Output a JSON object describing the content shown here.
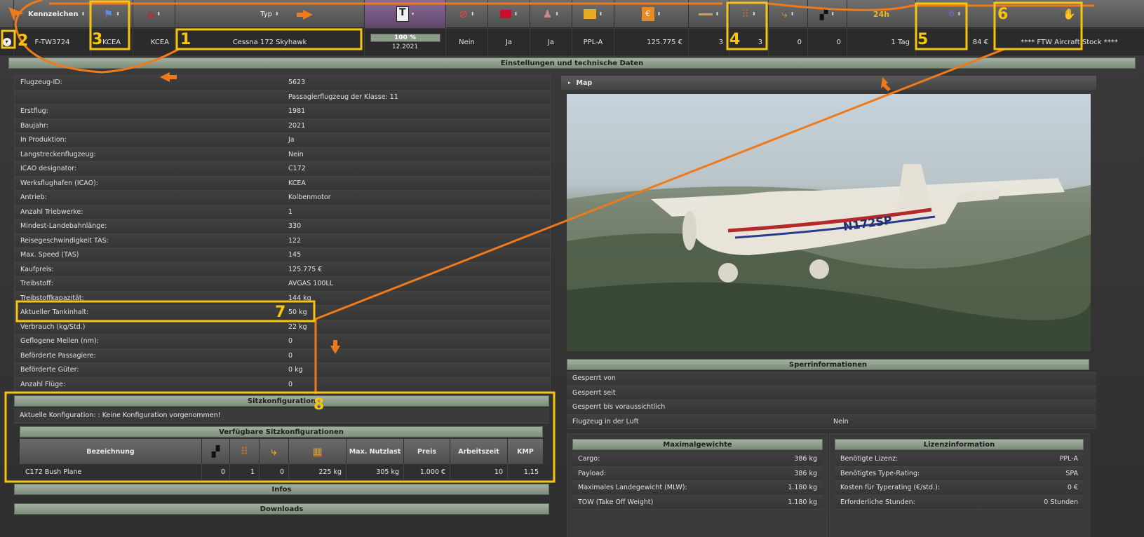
{
  "header": {
    "col_registration": "Kennzeichen",
    "col_type": "Typ",
    "col_24h": "24h"
  },
  "row": {
    "expand_icon": "chevron-down-icon",
    "registration": "F-TW3724",
    "location": "KCEA",
    "home": "KCEA",
    "type": "Cessna 172 Skyhawk",
    "condition_percent": "100 %",
    "condition_value": 1.0,
    "condition_date": "12.2021",
    "no_smoking": "Nein",
    "col_a": "Ja",
    "col_b": "Ja",
    "license": "PPL-A",
    "price": "125.775 €",
    "fuel_col": "3",
    "seats": "3",
    "cabin": "0",
    "first": "0",
    "rent_time": "1 Tag",
    "rent_price": "84 €",
    "owner": "**** FTW Aircraft Stock ****"
  },
  "section_title": "Einstellungen und technische Daten",
  "details": [
    {
      "k": "Flugzeug-ID:",
      "v": "5623"
    },
    {
      "k": "",
      "v": "Passagierflugzeug der Klasse: 11"
    },
    {
      "k": "Erstflug:",
      "v": "1981"
    },
    {
      "k": "Baujahr:",
      "v": "2021"
    },
    {
      "k": "In Produktion:",
      "v": "Ja"
    },
    {
      "k": "Langstreckenflugzeug:",
      "v": "Nein"
    },
    {
      "k": "ICAO designator:",
      "v": "C172"
    },
    {
      "k": "Werksflughafen (ICAO):",
      "v": "KCEA"
    },
    {
      "k": "Antrieb:",
      "v": "Kolbenmotor"
    },
    {
      "k": "Anzahl Triebwerke:",
      "v": "1"
    },
    {
      "k": "Mindest-Landebahnlänge:",
      "v": "330"
    },
    {
      "k": "Reisegeschwindigkeit TAS:",
      "v": "122"
    },
    {
      "k": "Max. Speed (TAS)",
      "v": "145"
    },
    {
      "k": "Kaufpreis:",
      "v": "125.775 €"
    },
    {
      "k": "Treibstoff:",
      "v": "AVGAS 100LL"
    },
    {
      "k": "Treibstoffkapazität:",
      "v": "144 kg"
    },
    {
      "k": "Aktueller Tankinhalt:",
      "v": "50 kg"
    },
    {
      "k": "Verbrauch (kg/Std.)",
      "v": "22 kg"
    },
    {
      "k": "Geflogene Meilen (nm):",
      "v": "0"
    },
    {
      "k": "Beförderte Passagiere:",
      "v": "0"
    },
    {
      "k": "Beförderte Güter:",
      "v": "0 kg"
    },
    {
      "k": "Anzahl Flüge:",
      "v": "0"
    }
  ],
  "seat": {
    "title": "Sitzkonfiguration",
    "current": "Aktuelle Konfiguration: : Keine Konfiguration vorgenommen!",
    "available_title": "Verfügbare Sitzkonfigurationen",
    "cols": {
      "name": "Bezeichnung",
      "payload": "Max. Nutzlast",
      "price": "Preis",
      "work": "Arbeitszeit",
      "kmp": "KMP"
    },
    "rows": [
      {
        "name": "C172 Bush Plane",
        "a": "0",
        "b": "1",
        "c": "0",
        "d": "225 kg",
        "payload": "305 kg",
        "price": "1.000 €",
        "work": "10",
        "kmp": "1,15"
      }
    ]
  },
  "infos": "Infos",
  "downloads": "Downloads",
  "map_label": "Map",
  "plane_reg": "N172SP",
  "lock": {
    "title": "Sperrinformationen",
    "rows": [
      {
        "k": "Gesperrt von",
        "v": ""
      },
      {
        "k": "Gesperrt seit",
        "v": ""
      },
      {
        "k": "Gesperrt bis voraussichtlich",
        "v": ""
      },
      {
        "k": "Flugzeug in der Luft",
        "v": "Nein"
      }
    ]
  },
  "weights": {
    "title": "Maximalgewichte",
    "rows": [
      {
        "k": "Cargo:",
        "v": "386 kg"
      },
      {
        "k": "Payload:",
        "v": "386 kg"
      },
      {
        "k": "Maximales Landegewicht (MLW):",
        "v": "1.180 kg"
      },
      {
        "k": "TOW (Take Off Weight)",
        "v": "1.180 kg"
      }
    ]
  },
  "license_info": {
    "title": "Lizenzinformation",
    "rows": [
      {
        "k": "Benötigte Lizenz:",
        "v": "PPL-A"
      },
      {
        "k": "Benötigtes Type-Rating:",
        "v": "SPA"
      },
      {
        "k": "Kosten für Typerating (€/std.):",
        "v": "0 €"
      },
      {
        "k": "Erforderliche Stunden:",
        "v": "0 Stunden"
      }
    ]
  },
  "annotations": [
    "1",
    "2",
    "3",
    "4",
    "5",
    "6",
    "7",
    "8"
  ],
  "colors": {
    "highlight": "#f7c50f",
    "arrow": "#f07a1a",
    "bar": "#8c9b8a"
  }
}
